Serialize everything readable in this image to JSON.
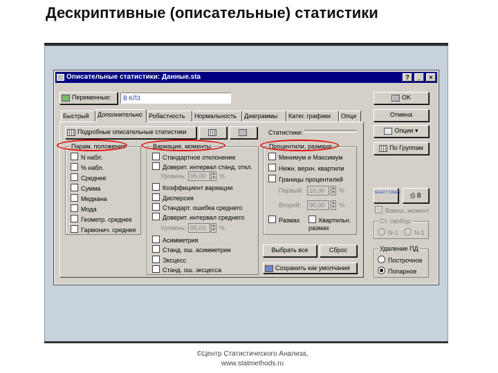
{
  "slide": {
    "title": "Дескриптивные (описательные) статистики",
    "footer_line1": "©Центр Статистического Анализа,",
    "footer_line2": "www.statmethods.ru"
  },
  "dialog": {
    "title": "Описательные статистики: Данные.sta",
    "titlebar_buttons": [
      "?",
      "_",
      "×"
    ],
    "variables_button": "Переменные:",
    "variables_value": "В КЛ3",
    "tabs": [
      "Быстрый",
      "Дополнительно",
      "Робастность",
      "Нормальность",
      "Диаграммы",
      "Катег. графики",
      "Опци"
    ],
    "active_tab": "Дополнительно",
    "full_stats_button": "Подробные описательные статистики",
    "statistics_label": "Статистики:",
    "side_buttons": {
      "ok": "OK",
      "cancel": "Отмена",
      "options": "Опции",
      "by_groups": "По Группам",
      "select_cases": "SELECT CASES",
      "print_icon_label": "В"
    },
    "weighted_moments": "Взвеш. момент",
    "df_group": {
      "label": "Ст. свобод",
      "options": [
        "N-1",
        "N-1"
      ]
    },
    "missing_group": {
      "label": "Удаление ПД",
      "options": [
        "Построчное",
        "Попарное"
      ],
      "selected": "Попарное"
    },
    "location_group": {
      "label": "Парам. положения",
      "items": [
        "N набл.",
        "% набл.",
        "Среднее",
        "Сумма",
        "Медиана",
        "Мода",
        "Геометр. среднее",
        "Гармонич. среднее"
      ]
    },
    "moments_group": {
      "label": "Вариация, моменты",
      "items_top": [
        "Стандартное отклонение",
        "Доверит. интервал станд. откл."
      ],
      "level1_label": "Уровень:",
      "level1_value": "95,00",
      "level1_unit": "%",
      "items_mid": [
        "Коэффициент вариации",
        "Дисперсия",
        "Стандарт. ошибка среднего",
        "Доверит. интервал среднего"
      ],
      "level2_label": "Уровень:",
      "level2_value": "95,00",
      "level2_unit": "%",
      "items_bottom": [
        "Асимметрия",
        "Станд. ош. асимметрии",
        "Эксцесс",
        "Станд. ош. эксцесса"
      ]
    },
    "percentiles_group": {
      "label": "Процентили, размахи",
      "items": [
        "Минимум и Максимум",
        "Нижн. верхн. квартили",
        "Границы процентилей"
      ],
      "first_label": "Первый:",
      "first_value": "10,00",
      "second_label": "Второй:",
      "second_value": "90,00",
      "unit": "%",
      "range_label": "Размах",
      "quartile_range_label": "Квартильн. размах"
    },
    "select_all_button": "Выбрать все",
    "reset_button": "Сброс",
    "save_default_button": "Сохранить как умолчания"
  }
}
